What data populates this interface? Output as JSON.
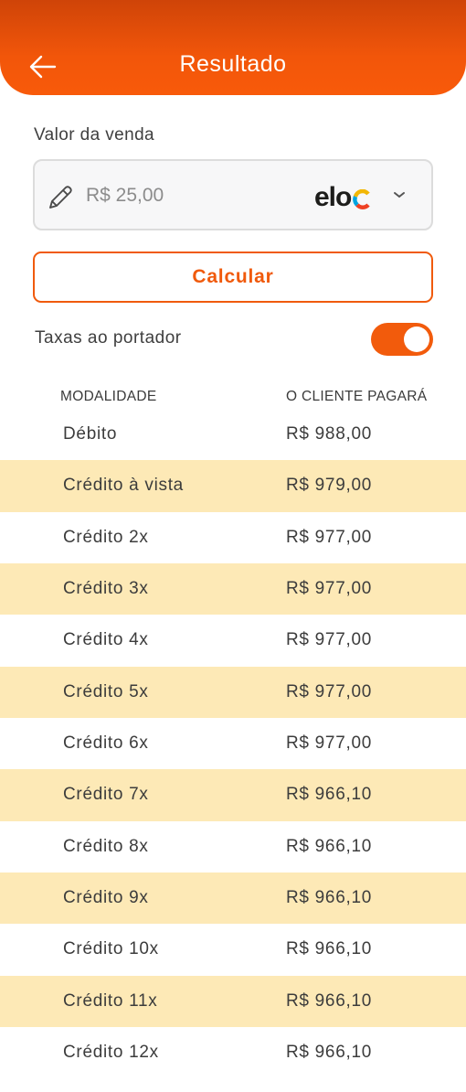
{
  "header": {
    "title": "Resultado"
  },
  "sale": {
    "label": "Valor da venda",
    "value": "R$ 25,00",
    "brand": "elo"
  },
  "calculate_label": "Calcular",
  "carrier_fees": {
    "label": "Taxas ao portador",
    "enabled": true
  },
  "table": {
    "headers": [
      "MODALIDADE",
      "O CLIENTE PAGARÁ"
    ],
    "rows": [
      {
        "mode": "Débito",
        "amount": "R$ 988,00"
      },
      {
        "mode": "Crédito à vista",
        "amount": "R$ 979,00"
      },
      {
        "mode": "Crédito 2x",
        "amount": "R$ 977,00"
      },
      {
        "mode": "Crédito 3x",
        "amount": "R$ 977,00"
      },
      {
        "mode": "Crédito 4x",
        "amount": "R$ 977,00"
      },
      {
        "mode": "Crédito 5x",
        "amount": "R$ 977,00"
      },
      {
        "mode": "Crédito 6x",
        "amount": "R$ 977,00"
      },
      {
        "mode": "Crédito 7x",
        "amount": "R$ 966,10"
      },
      {
        "mode": "Crédito 8x",
        "amount": "R$ 966,10"
      },
      {
        "mode": "Crédito 9x",
        "amount": "R$ 966,10"
      },
      {
        "mode": "Crédito 10x",
        "amount": "R$ 966,10"
      },
      {
        "mode": "Crédito 11x",
        "amount": "R$ 966,10"
      },
      {
        "mode": "Crédito 12x",
        "amount": "R$ 966,10"
      }
    ]
  },
  "colors": {
    "accent": "#f25b0c",
    "row_highlight": "#fde9b6",
    "header_top": "#cf4408"
  },
  "icons": {
    "back": "arrow-left-icon",
    "edit": "pencil-icon",
    "dropdown": "chevron-down-icon"
  }
}
